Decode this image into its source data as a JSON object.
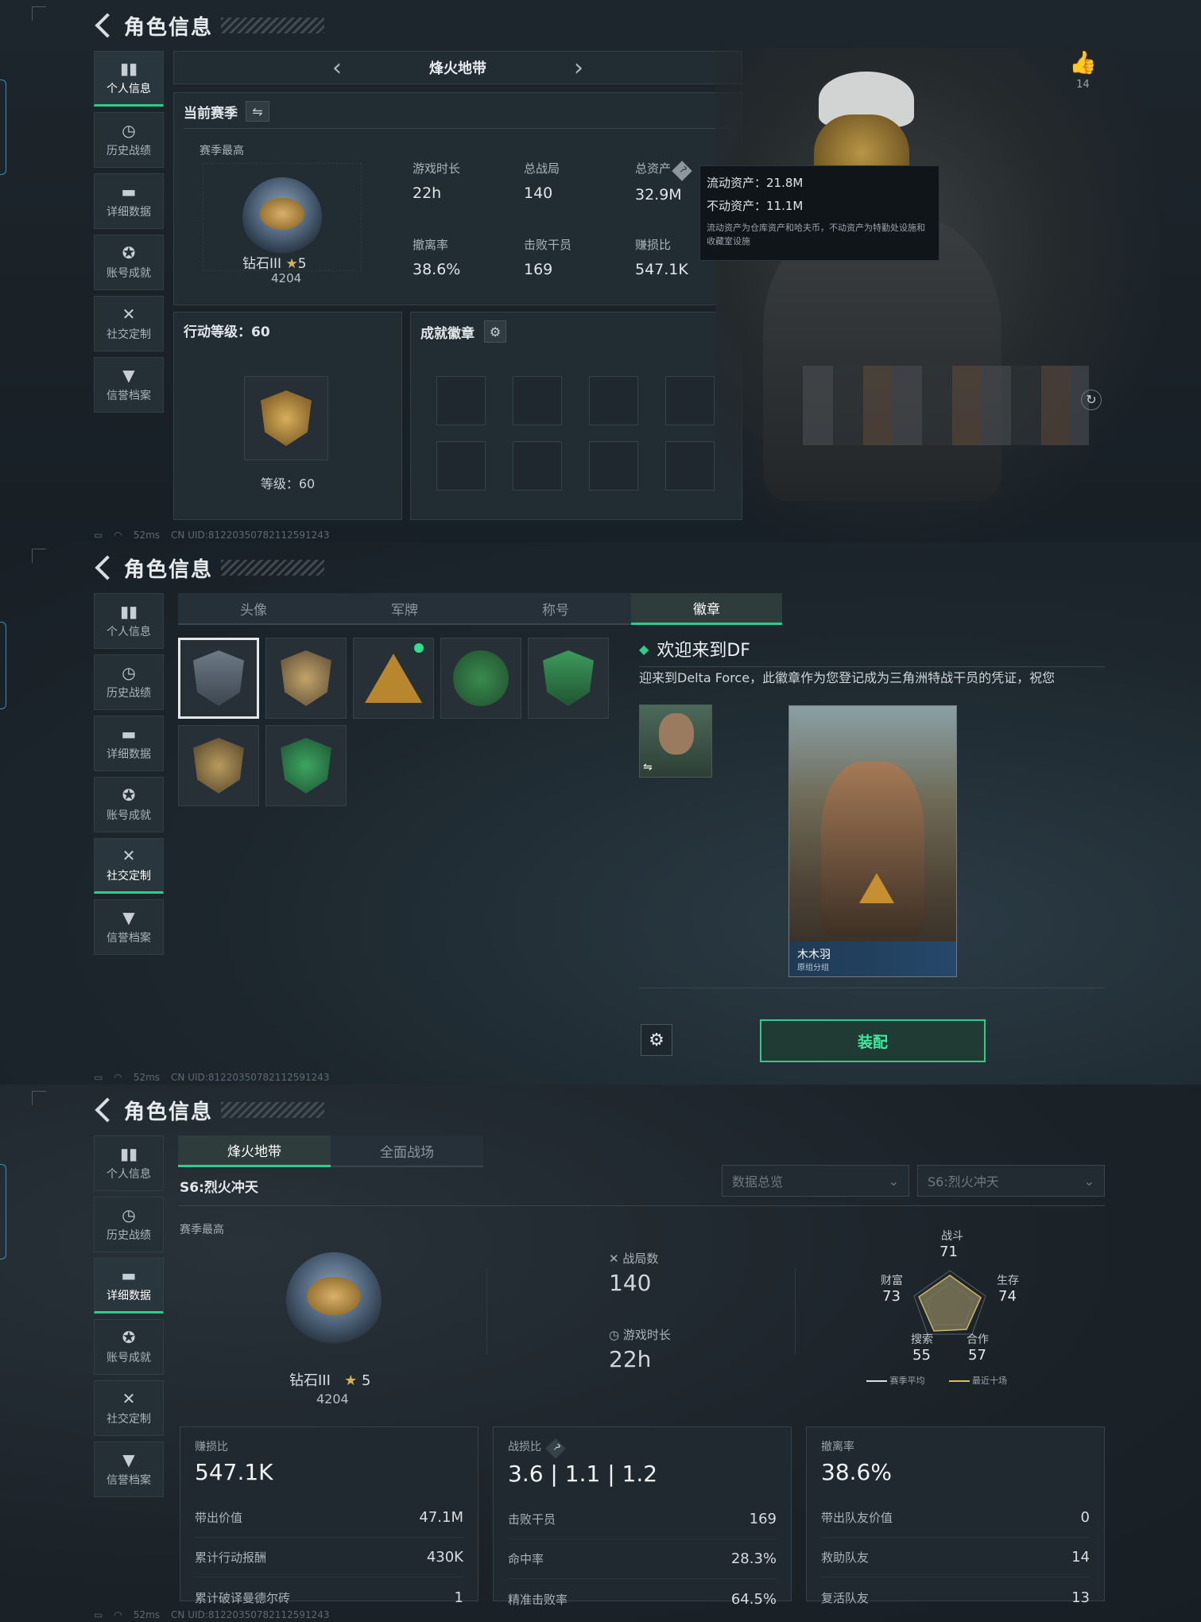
{
  "common": {
    "title": "角色信息",
    "uid": "CN UID:812203507821125912​43",
    "ping": "52ms"
  },
  "sidebar": [
    {
      "label": "个人信息",
      "icon": "bar-chart-icon"
    },
    {
      "label": "历史战绩",
      "icon": "clock-icon"
    },
    {
      "label": "详细数据",
      "icon": "folder-icon"
    },
    {
      "label": "账号成就",
      "icon": "medal-icon"
    },
    {
      "label": "社交定制",
      "icon": "tools-icon"
    },
    {
      "label": "信誉档案",
      "icon": "shield-check-icon"
    }
  ],
  "s1": {
    "mode": "烽火地带",
    "season_label": "当前赛季",
    "season_high": "赛季最高",
    "rank": "钻石III",
    "stars": "5",
    "score": "4204",
    "stats": [
      {
        "label": "游戏时长",
        "value": "22h"
      },
      {
        "label": "总战局",
        "value": "140"
      },
      {
        "label": "总资产",
        "value": "32.9M"
      },
      {
        "label": "撤离率",
        "value": "38.6%"
      },
      {
        "label": "击败干员",
        "value": "169"
      },
      {
        "label": "赚损比",
        "value": "547.1K"
      }
    ],
    "tooltip": {
      "liquid": "流动资产：21.8M",
      "fixed": "不动资产：11.1M",
      "note": "流动资产为仓库资产和哈夫币，不动资产为特勤处设施和收藏室设施"
    },
    "level_title": "行动等级：60",
    "level_text": "等级：60",
    "achieve_title": "成就徽章",
    "likes": "14"
  },
  "s2": {
    "tabs": [
      "头像",
      "军牌",
      "称号",
      "徽章"
    ],
    "badge_title": "欢迎来到DF",
    "badge_desc": "迎来到Delta Force，此徽章作为您登记成为三角洲特战干员的凭证，祝您",
    "card_name": "木木羽",
    "card_sub": "原组分组",
    "equip": "装配"
  },
  "s3": {
    "tabs": [
      "烽火地带",
      "全面战场"
    ],
    "season": "S6:烈火冲天",
    "dd1": "数据总览",
    "dd2": "S6:烈火冲天",
    "season_high": "赛季最高",
    "rank": "钻石III",
    "stars": "5",
    "score": "4204",
    "games_label": "战局数",
    "games": "140",
    "time_label": "游戏时长",
    "time": "22h",
    "radar": {
      "combat_l": "战斗",
      "combat": "71",
      "wealth_l": "财富",
      "wealth": "73",
      "survive_l": "生存",
      "survive": "74",
      "search_l": "搜索",
      "search": "55",
      "coop_l": "合作",
      "coop": "57",
      "legend1": "赛季平均",
      "legend2": "最近十场"
    },
    "boxes": [
      {
        "head": "赚损比",
        "big": "547.1K",
        "rows": [
          [
            "带出价值",
            "47.1M"
          ],
          [
            "累计行动报酬",
            "430K"
          ],
          [
            "累计破译曼德尔砖",
            "1"
          ]
        ]
      },
      {
        "head": "战损比",
        "big": "3.6 | 1.1 | 1.2",
        "rows": [
          [
            "击败干员",
            "169"
          ],
          [
            "命中率",
            "28.3%"
          ],
          [
            "精准击败率",
            "64.5%"
          ]
        ]
      },
      {
        "head": "撤离率",
        "big": "38.6%",
        "rows": [
          [
            "带出队友价值",
            "0"
          ],
          [
            "救助队友",
            "14"
          ],
          [
            "复活队友",
            "13"
          ]
        ]
      }
    ]
  }
}
